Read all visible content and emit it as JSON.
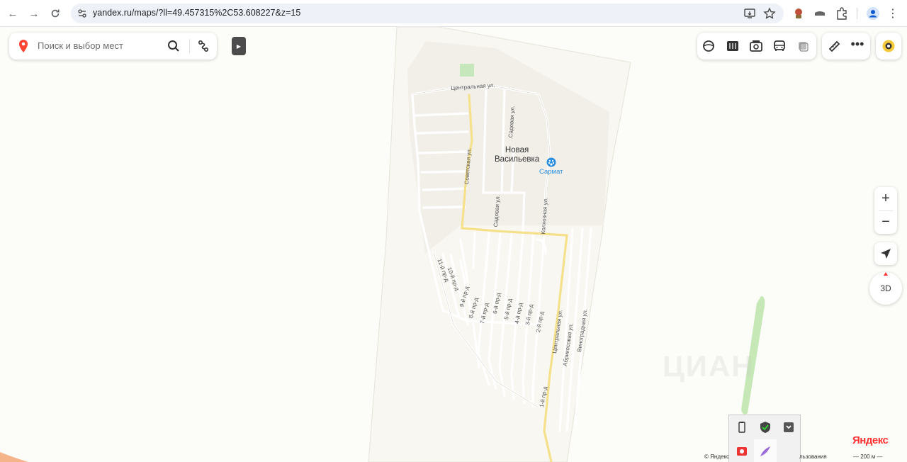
{
  "browser": {
    "url": "yandex.ru/maps/?ll=49.457315%2C53.608227&z=15"
  },
  "search": {
    "placeholder": "Поиск и выбор мест"
  },
  "map": {
    "settlement": "Новая\nВасильевка",
    "poi": "Сармат",
    "streets": {
      "central_top": "Центральная ул.",
      "sadovaya_1": "Садовая ул.",
      "sovetskaya": "Советская ул.",
      "sadovaya_2": "Садовая ул.",
      "kolkhoznaya": "Колхозная ул.",
      "central_right": "Центральная ул.",
      "abrikosovaya": "Абрикосовая ул.",
      "vinogradnaya": "Виноградная ул.",
      "pr11": "11-й пр-д",
      "pr10": "10-й пр-д",
      "pr9": "9-й пр-д",
      "pr8": "8-й пр-д",
      "pr7": "7-й пр-д",
      "pr6": "6-й пр-д",
      "pr5": "5-й пр-д",
      "pr4": "4-й пр-д",
      "pr3": "3-й пр-д",
      "pr2": "2-й пр-д",
      "pr1": "1-й пр-д"
    }
  },
  "controls": {
    "zoom_in": "+",
    "zoom_out": "−",
    "view_3d": "3D"
  },
  "footer": {
    "logo": "Яндекс",
    "scale": "— 200 м —",
    "copyright": "© Яндекс",
    "terms": "льзования"
  },
  "watermark": "ЦИАН",
  "colors": {
    "road_main": "#f5e18c",
    "road_minor": "#ffffff",
    "settlement_fill": "#f2efe9",
    "map_bg": "#fcfcf8",
    "poi": "#2d8ee0",
    "park": "#c6e6bb",
    "logo_red": "#ff3333"
  }
}
